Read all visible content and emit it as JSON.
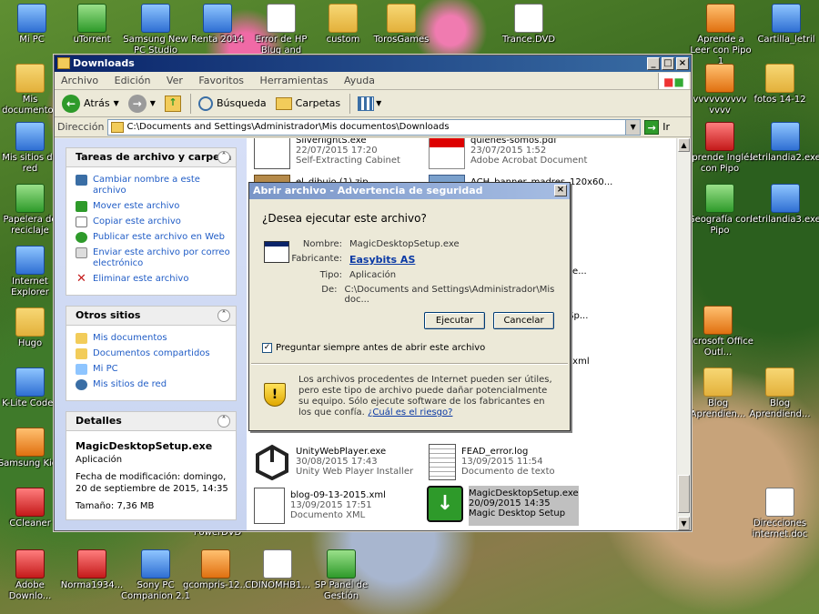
{
  "desktop": {
    "icons": [
      {
        "label": "Mi PC"
      },
      {
        "label": "uTorrent"
      },
      {
        "label": "Samsung New PC Studio"
      },
      {
        "label": "Renta 2014"
      },
      {
        "label": "Error de HP Blug and"
      },
      {
        "label": "custom"
      },
      {
        "label": "TorosGames"
      },
      {
        "label": "Trance.DVD"
      },
      {
        "label": "Aprende a Leer con Pipo 1"
      },
      {
        "label": "Cartilla_letril"
      },
      {
        "label": "Mis documentos"
      },
      {
        "label": "vvvvvvvvvv vvvv"
      },
      {
        "label": "fotos 14-12"
      },
      {
        "label": "Mis sitios de red"
      },
      {
        "label": "Aprende Inglés con Pipo"
      },
      {
        "label": "letrilandia2.exe"
      },
      {
        "label": "Papelera de reciclaje"
      },
      {
        "label": "Geografía con Pipo"
      },
      {
        "label": "letrilandia3.exe"
      },
      {
        "label": "Internet Explorer"
      },
      {
        "label": "Hugo"
      },
      {
        "label": "Microsoft Office Outl..."
      },
      {
        "label": "K-Lite Codec"
      },
      {
        "label": "Blog Aprendien..."
      },
      {
        "label": "Blog Aprendiend..."
      },
      {
        "label": "Samsung Kies"
      },
      {
        "label": "CCleaner"
      },
      {
        "label": "PowerDVD"
      },
      {
        "label": "Direcciones internet.doc"
      },
      {
        "label": "Adobe Downlo..."
      },
      {
        "label": "Norma1934..."
      },
      {
        "label": "Sony PC Companion 2.1"
      },
      {
        "label": "gcompris-12..."
      },
      {
        "label": "CDINOMHB1..."
      },
      {
        "label": "SP Panel de Gestión"
      }
    ]
  },
  "explorer": {
    "title": "Downloads",
    "menu": [
      "Archivo",
      "Edición",
      "Ver",
      "Favoritos",
      "Herramientas",
      "Ayuda"
    ],
    "toolbar": {
      "back": "Atrás",
      "search": "Búsqueda",
      "folders": "Carpetas"
    },
    "address": {
      "label": "Dirección",
      "value": "C:\\Documents and Settings\\Administrador\\Mis documentos\\Downloads",
      "go": "Ir"
    },
    "tasks": {
      "title": "Tareas de archivo y carpeta",
      "items": [
        "Cambiar nombre a este archivo",
        "Mover este archivo",
        "Copiar este archivo",
        "Publicar este archivo en Web",
        "Enviar este archivo por correo electrónico",
        "Eliminar este archivo"
      ]
    },
    "other_places": {
      "title": "Otros sitios",
      "items": [
        "Mis documentos",
        "Documentos compartidos",
        "Mi PC",
        "Mis sitios de red"
      ]
    },
    "details": {
      "title": "Detalles",
      "name": "MagicDesktopSetup.exe",
      "type": "Aplicación",
      "modified": "Fecha de modificación: domingo, 20 de septiembre de 2015, 14:35",
      "size": "Tamaño: 7,36 MB"
    },
    "files": [
      {
        "name": "SilverlightS.exe",
        "date": "22/07/2015 17:20",
        "type": "Self-Extracting Cabinet"
      },
      {
        "name": "quienes-somos.pdf",
        "date": "23/07/2015 1:52",
        "type": "Adobe Acrobat Document"
      },
      {
        "name": "el_dibujo (1).zip",
        "date": "",
        "type": ""
      },
      {
        "name": "ACH_banner_madres_120x60...",
        "date": "",
        "type": ""
      },
      {
        "name": "UnityWebPlayer.exe",
        "date": "30/08/2015 17:43",
        "type": "Unity Web Player Installer"
      },
      {
        "name": "FEAD_error.log",
        "date": "13/09/2015 11:54",
        "type": "Documento de texto"
      },
      {
        "name": "blog-09-13-2015.xml",
        "date": "13/09/2015 17:51",
        "type": "Documento XML"
      },
      {
        "name": "MagicDesktopSetup.exe",
        "date": "20/09/2015 14:35",
        "type": "Magic Desktop Setup"
      }
    ],
    "partial_labels": [
      "ree...",
      ".Sp...",
      ".xml"
    ]
  },
  "dialog": {
    "title": "Abrir archivo - Advertencia de seguridad",
    "question": "¿Desea ejecutar este archivo?",
    "fields": [
      {
        "label": "Nombre:",
        "value": "MagicDesktopSetup.exe"
      },
      {
        "label": "Fabricante:",
        "value": "Easybits AS"
      },
      {
        "label": "Tipo:",
        "value": "Aplicación"
      },
      {
        "label": "De:",
        "value": "C:\\Documents and Settings\\Administrador\\Mis doc..."
      }
    ],
    "run_button": "Ejecutar",
    "cancel_button": "Cancelar",
    "checkbox_label": "Preguntar siempre antes de abrir este archivo",
    "checkbox_checked": true,
    "warning_text": "Los archivos procedentes de Internet pueden ser útiles, pero este tipo de archivo puede dañar potencialmente su equipo. Sólo ejecute software de los fabricantes en los que confía.",
    "warning_link": "¿Cuál es el riesgo?"
  }
}
